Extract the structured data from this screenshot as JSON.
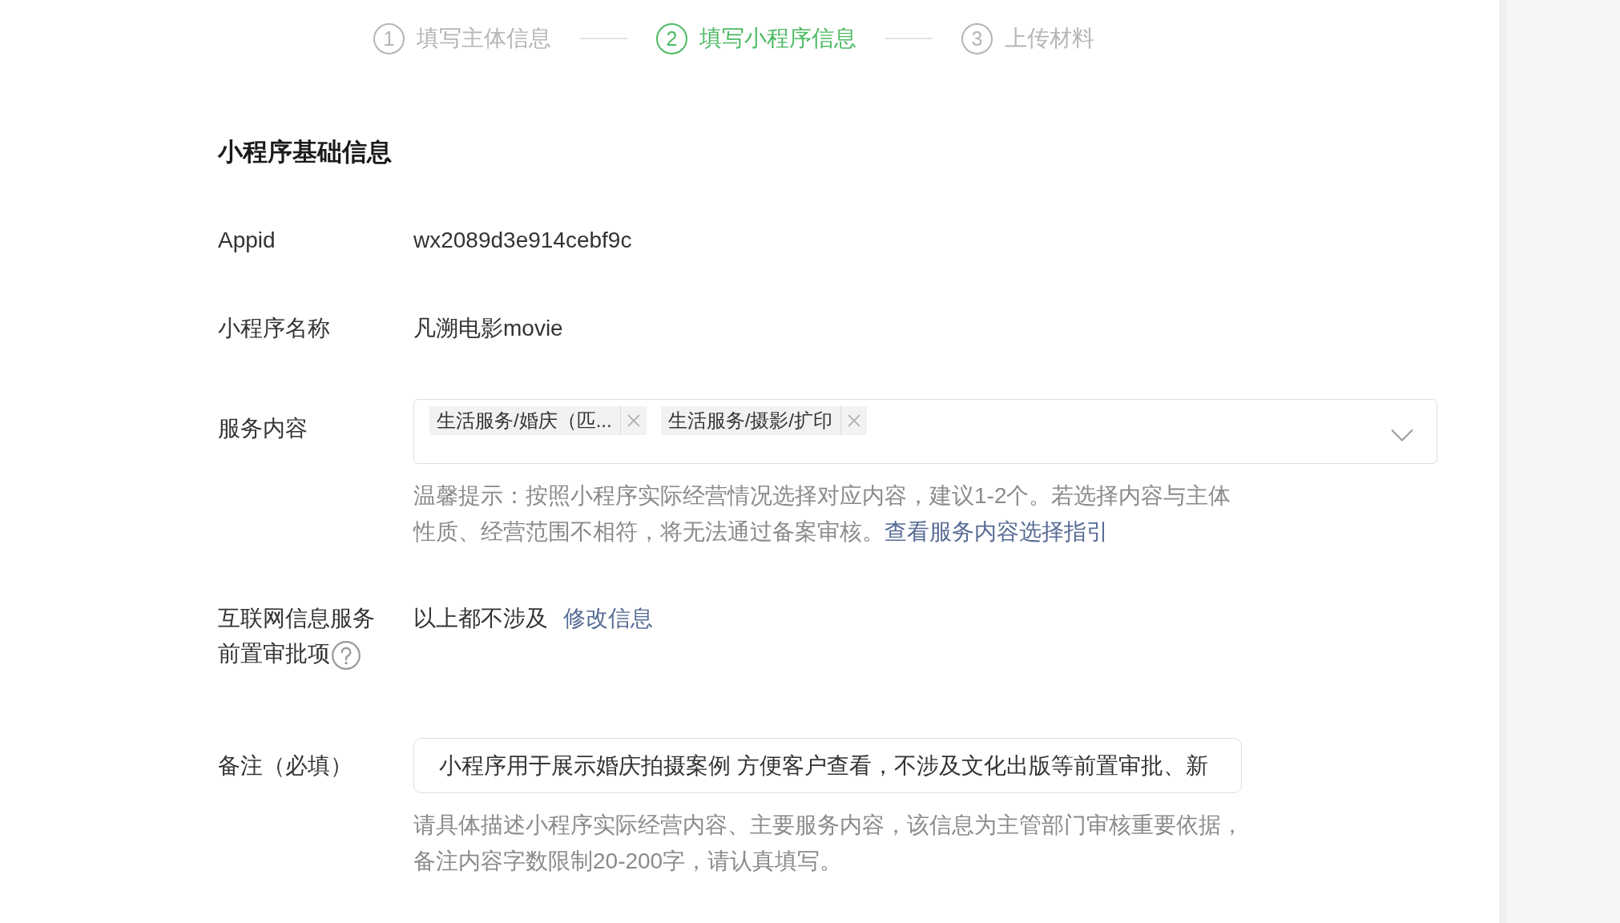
{
  "steps": [
    {
      "number": "1",
      "label": "填写主体信息",
      "selected": false
    },
    {
      "number": "2",
      "label": "填写小程序信息",
      "selected": true
    },
    {
      "number": "3",
      "label": "上传材料",
      "selected": false
    }
  ],
  "section": {
    "title": "小程序基础信息"
  },
  "fields": [
    {
      "kind": "text",
      "label": "Appid",
      "value": "wx2089d3e914cebf9c"
    },
    {
      "kind": "text",
      "label": "小程序名称",
      "value": "凡溯电影movie"
    },
    {
      "kind": "select",
      "label": "服务内容",
      "tags": [
        {
          "label": "生活服务/婚庆（匹..."
        },
        {
          "label": "生活服务/摄影/扩印"
        }
      ],
      "hint": "温馨提示：按照小程序实际经营情况选择对应内容，建议1-2个。若选择内容与主体性质、经营范围不相符，将无法通过备案审核。",
      "hint_link": "查看服务内容选择指引"
    },
    {
      "kind": "approval",
      "label_lines": [
        "互联网信息服务",
        "前置审批项"
      ],
      "help": true,
      "value": "以上都不涉及",
      "link": "修改信息"
    },
    {
      "kind": "input",
      "label": "备注（必填）",
      "value": "小程序用于展示婚庆拍摄案例 方便客户查看，不涉及文化出版等前置审批、新",
      "hint": "请具体描述小程序实际经营内容、主要服务内容，该信息为主管部门审核重要依据，备注内容字数限制20-200字，请认真填写。"
    }
  ]
}
